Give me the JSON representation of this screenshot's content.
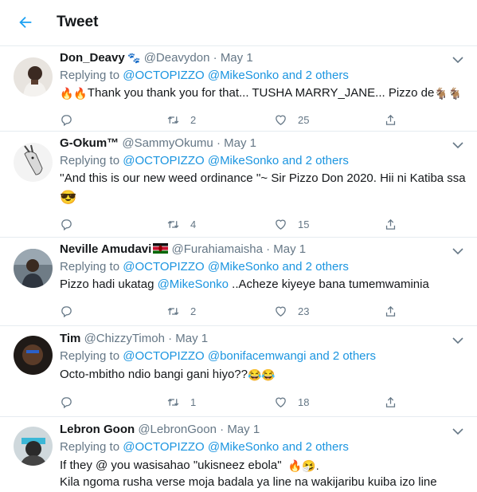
{
  "header": {
    "title": "Tweet"
  },
  "tweets": [
    {
      "name": "Don_Deavy",
      "handle": "@Deavydon",
      "date": "May 1",
      "reply_prefix": "Replying to",
      "reply_to": "@OCTOPIZZO @MikeSonko and 2 others",
      "emoji_lead": "🔥🔥",
      "text": "Thank you thank you for that... TUSHA MARRY_JANE... Pizzo de",
      "emoji_tail": "🐐🐐",
      "reply_count": "",
      "retweet_count": "2",
      "like_count": "25"
    },
    {
      "name": "G-Okum™",
      "handle": "@SammyOkumu",
      "date": "May 1",
      "reply_prefix": "Replying to",
      "reply_to": "@OCTOPIZZO @MikeSonko and 2 others",
      "text": "''And this is our new weed ordinance ''~ Sir Pizzo Don 2020. Hii ni Katiba ssa",
      "emoji_line2": "😎",
      "reply_count": "",
      "retweet_count": "4",
      "like_count": "15"
    },
    {
      "name": "Neville Amudavi",
      "handle": "@Furahiamaisha",
      "date": "May 1",
      "reply_prefix": "Replying to",
      "reply_to": "@OCTOPIZZO @MikeSonko and 2 others",
      "text_pre": "Pizzo hadi ukatag ",
      "text_mention": "@MikeSonko",
      "text_post": " ..Acheze kiyeye bana tumemwaminia",
      "reply_count": "",
      "retweet_count": "2",
      "like_count": "23"
    },
    {
      "name": "Tim",
      "handle": "@ChizzyTimoh",
      "date": "May 1",
      "reply_prefix": "Replying to",
      "reply_to": "@OCTOPIZZO @bonifacemwangi and 2 others",
      "text": "Octo-mbitho ndio bangi gani hiyo??",
      "emoji_tail": "😂😂",
      "reply_count": "",
      "retweet_count": "1",
      "like_count": "18"
    },
    {
      "name": "Lebron Goon",
      "handle": "@LebronGoon",
      "date": "May 1",
      "reply_prefix": "Replying to",
      "reply_to": "@OCTOPIZZO @MikeSonko and 2 others",
      "text": "If they @ you wasisahao \"ukisneez ebola\"",
      "emoji_tail": "🔥🤧.",
      "text_line2": "Kila ngoma rusha verse moja badala ya line na wakijaribu kuiba izo line"
    }
  ],
  "colors": {
    "accent": "#1da1f2",
    "mention": "#1b95e0",
    "muted": "#657786",
    "divider": "#e6ecf0"
  },
  "icons": [
    "back-arrow-icon",
    "chevron-down-icon",
    "reply-icon",
    "retweet-icon",
    "like-icon",
    "share-icon"
  ]
}
